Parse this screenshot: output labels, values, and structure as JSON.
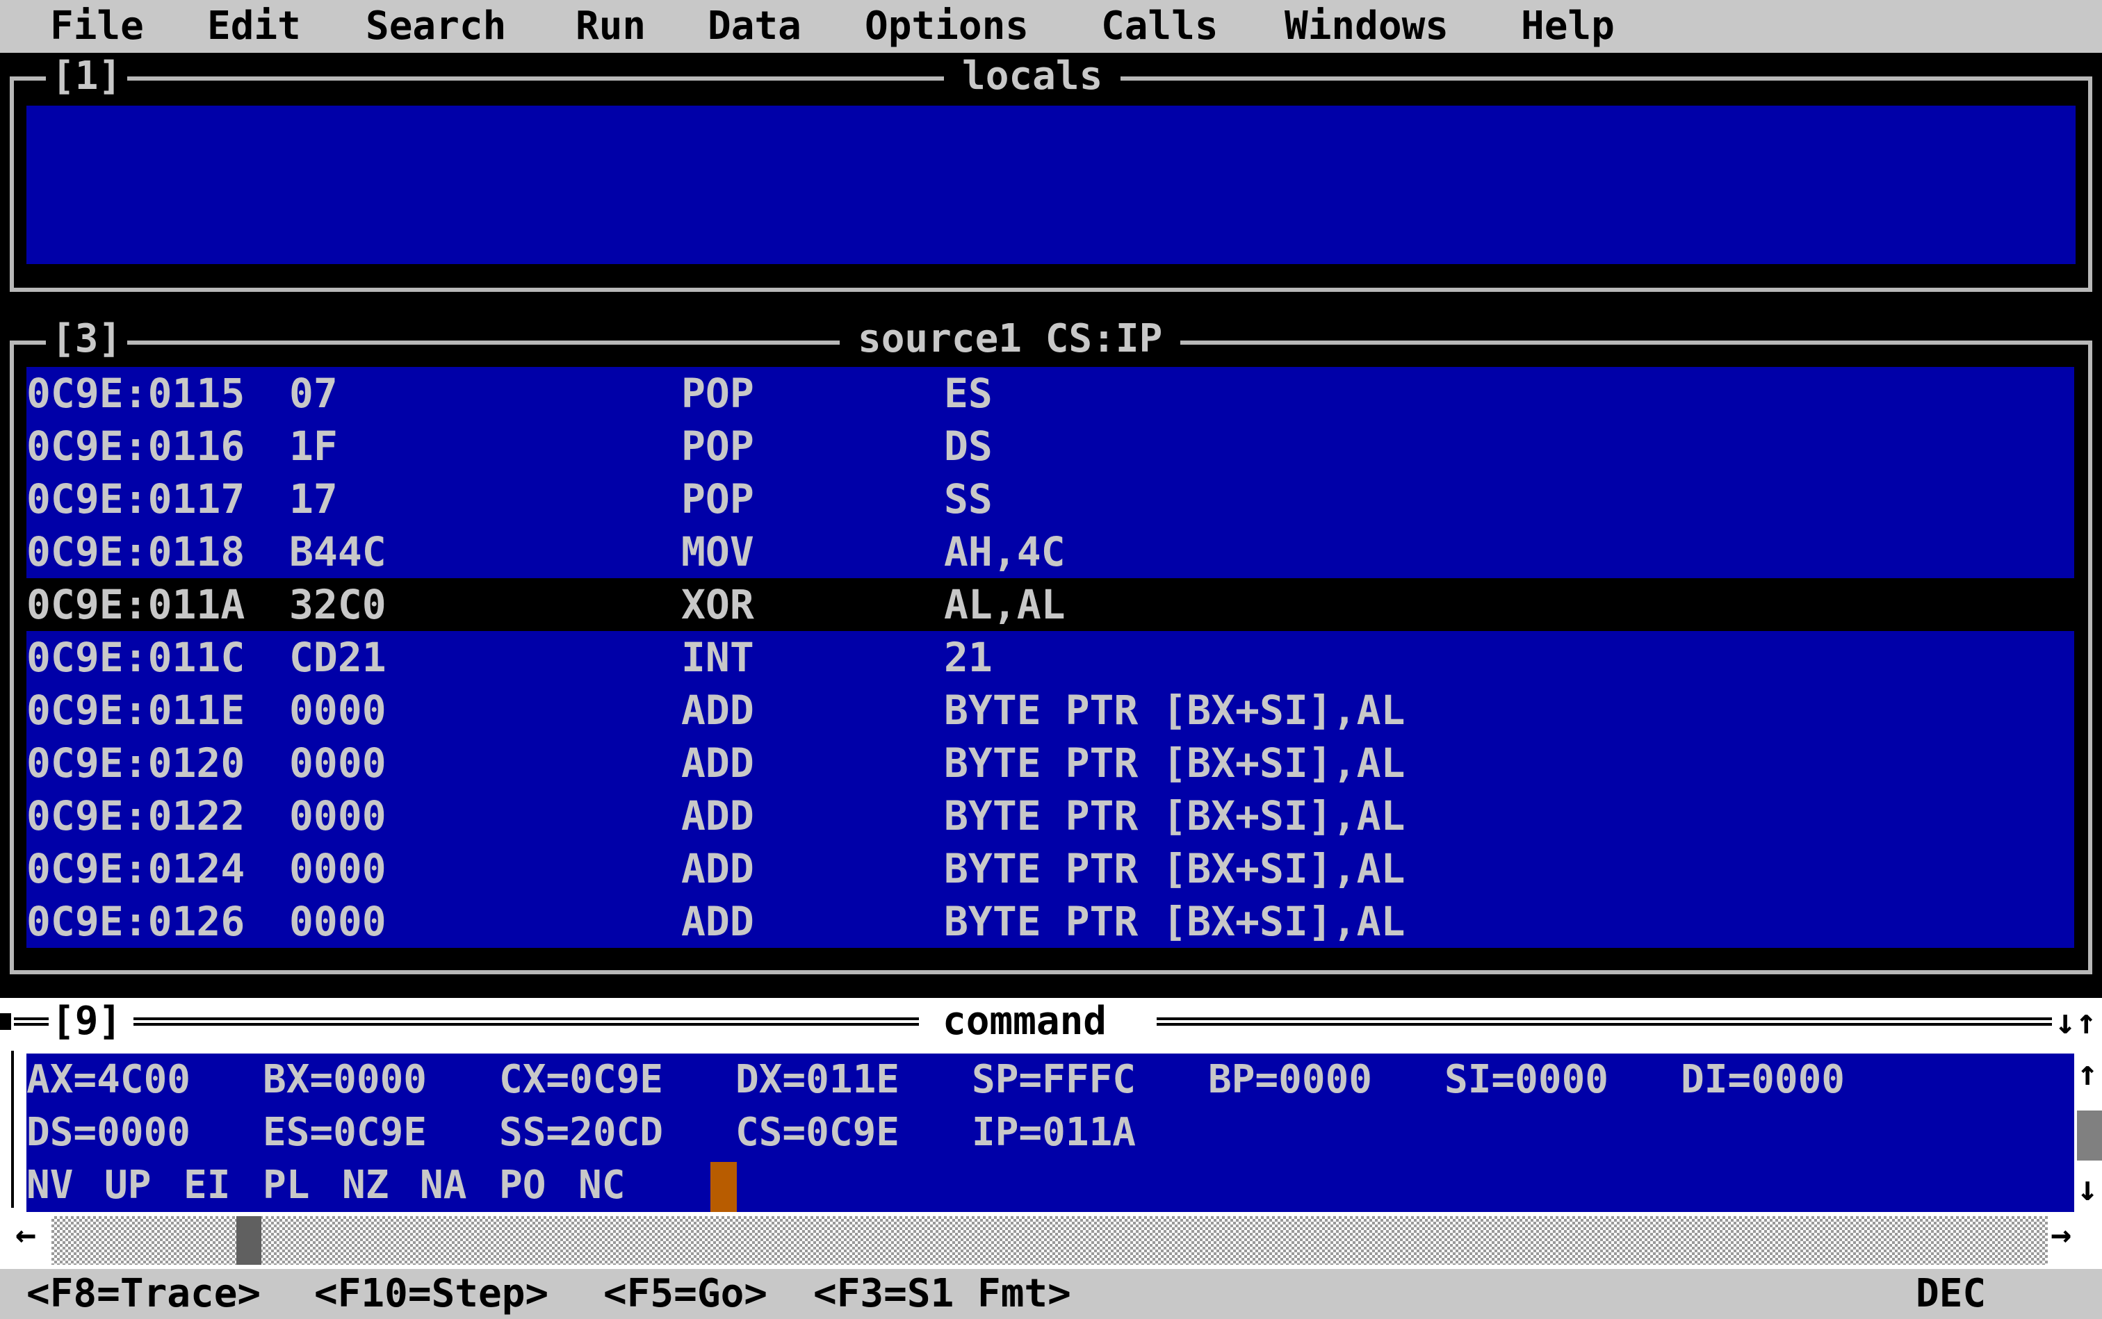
{
  "menu": [
    "File",
    "Edit",
    "Search",
    "Run",
    "Data",
    "Options",
    "Calls",
    "Windows",
    "Help"
  ],
  "locals_window": {
    "number": "[1]",
    "title": "locals"
  },
  "source_window": {
    "number": "[3]",
    "title": "source1 CS:IP",
    "rows": [
      {
        "addr": "0C9E:0115",
        "bytes": "07",
        "mnem": "POP",
        "operands": "ES"
      },
      {
        "addr": "0C9E:0116",
        "bytes": "1F",
        "mnem": "POP",
        "operands": "DS"
      },
      {
        "addr": "0C9E:0117",
        "bytes": "17",
        "mnem": "POP",
        "operands": "SS"
      },
      {
        "addr": "0C9E:0118",
        "bytes": "B44C",
        "mnem": "MOV",
        "operands": "AH,4C"
      },
      {
        "addr": "0C9E:011A",
        "bytes": "32C0",
        "mnem": "XOR",
        "operands": "AL,AL"
      },
      {
        "addr": "0C9E:011C",
        "bytes": "CD21",
        "mnem": "INT",
        "operands": "21"
      },
      {
        "addr": "0C9E:011E",
        "bytes": "0000",
        "mnem": "ADD",
        "operands": "BYTE PTR [BX+SI],AL"
      },
      {
        "addr": "0C9E:0120",
        "bytes": "0000",
        "mnem": "ADD",
        "operands": "BYTE PTR [BX+SI],AL"
      },
      {
        "addr": "0C9E:0122",
        "bytes": "0000",
        "mnem": "ADD",
        "operands": "BYTE PTR [BX+SI],AL"
      },
      {
        "addr": "0C9E:0124",
        "bytes": "0000",
        "mnem": "ADD",
        "operands": "BYTE PTR [BX+SI],AL"
      },
      {
        "addr": "0C9E:0126",
        "bytes": "0000",
        "mnem": "ADD",
        "operands": "BYTE PTR [BX+SI],AL"
      }
    ],
    "selected_index": 4
  },
  "command_window": {
    "number": "[9]",
    "title": "command",
    "registers_row1": [
      "AX=4C00",
      "BX=0000",
      "CX=0C9E",
      "DX=011E",
      "SP=FFFC",
      "BP=0000",
      "SI=0000",
      "DI=0000"
    ],
    "registers_row2": [
      "DS=0000",
      "ES=0C9E",
      "SS=20CD",
      "CS=0C9E",
      "IP=011A"
    ],
    "flags": [
      "NV",
      "UP",
      "EI",
      "PL",
      "NZ",
      "NA",
      "PO",
      "NC"
    ]
  },
  "colors": {
    "pane_blue": "#0000a8",
    "cursor_orange": "#b85c00",
    "menubar_gray": "#c8c8c8"
  },
  "icons": {
    "maximize": "down-up-arrows-icon",
    "scroll_up": "arrow-up-icon",
    "scroll_down": "arrow-down-icon",
    "scroll_left": "arrow-left-icon",
    "scroll_right": "arrow-right-icon"
  },
  "status_bar": {
    "keys": [
      "<F8=Trace>",
      "<F10=Step>",
      "<F5=Go>",
      "<F3=S1 Fmt>"
    ],
    "mode": "DEC"
  }
}
